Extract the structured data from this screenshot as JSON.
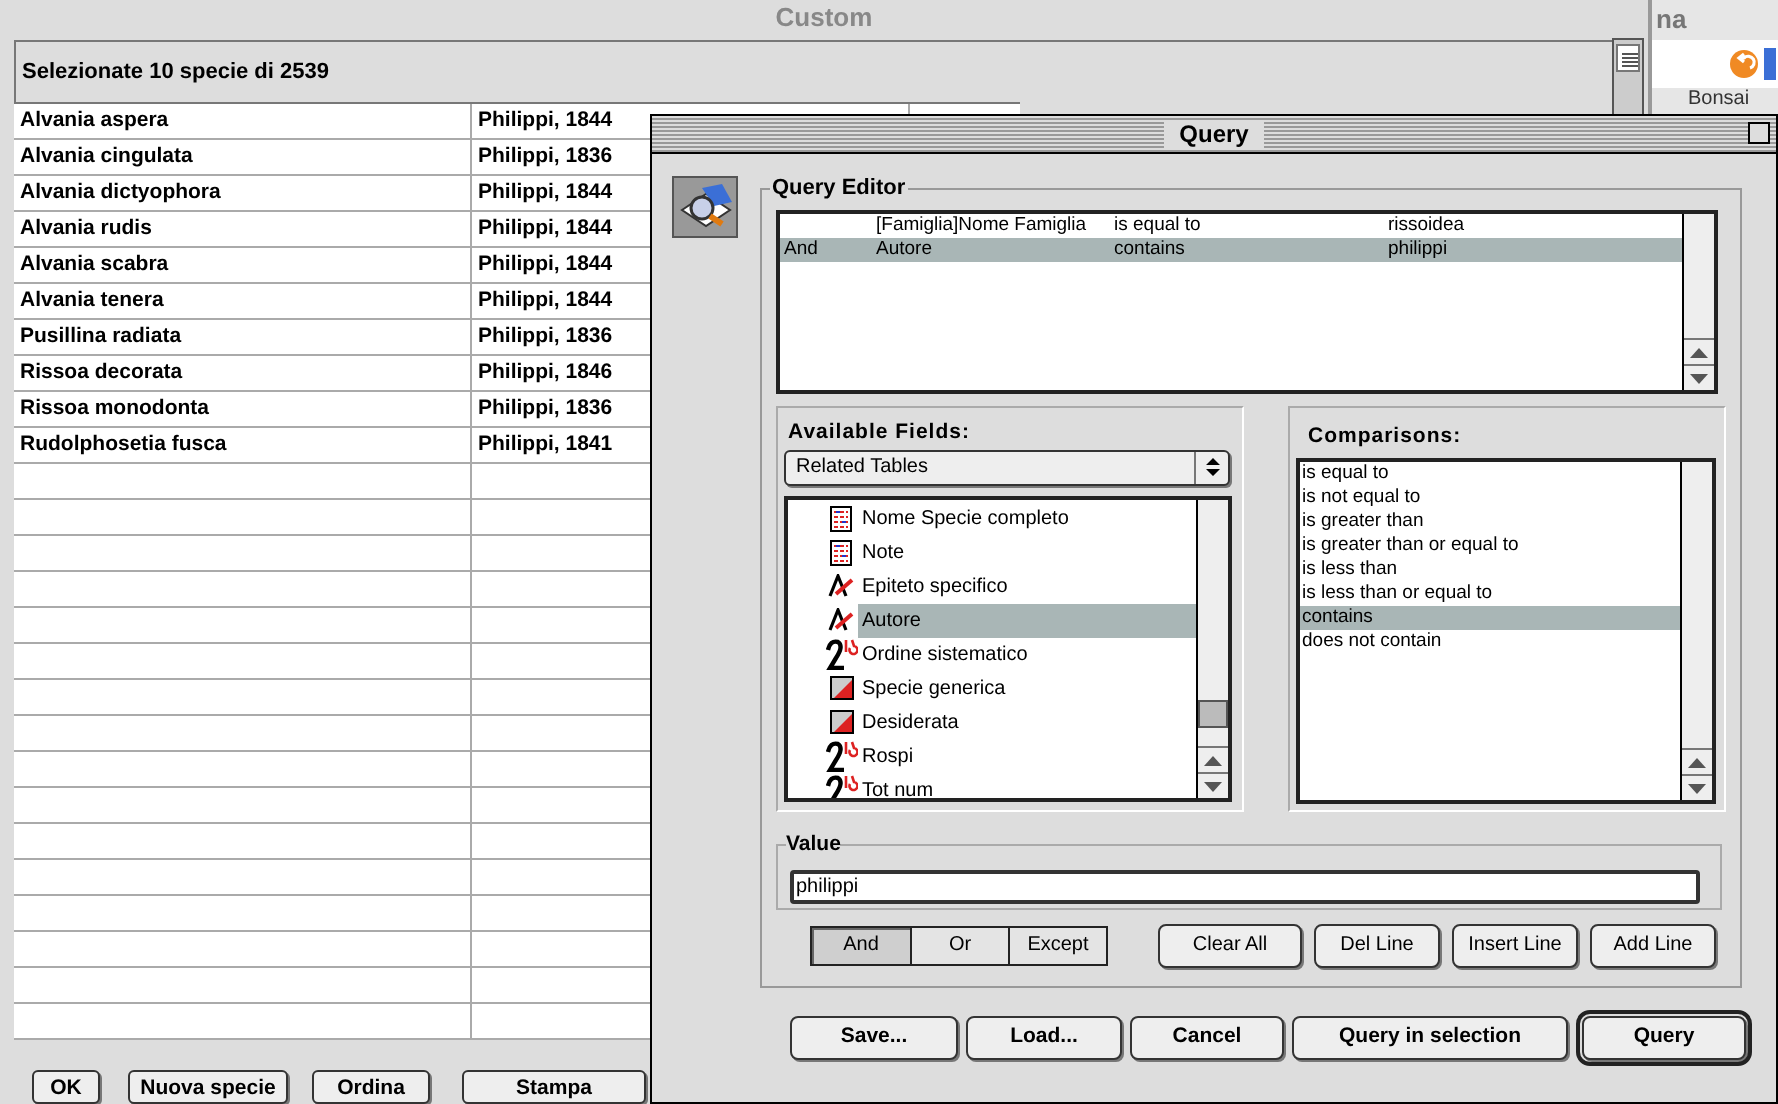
{
  "custom_window": {
    "title": "Custom",
    "header": "Selezionate 10 specie di 2539",
    "rows": [
      {
        "name": "Alvania aspera",
        "author": "Philippi, 1844"
      },
      {
        "name": "Alvania cingulata",
        "author": "Philippi, 1836"
      },
      {
        "name": "Alvania dictyophora",
        "author": "Philippi, 1844"
      },
      {
        "name": "Alvania rudis",
        "author": "Philippi, 1844"
      },
      {
        "name": "Alvania scabra",
        "author": "Philippi, 1844"
      },
      {
        "name": "Alvania tenera",
        "author": "Philippi, 1844"
      },
      {
        "name": "Pusillina radiata",
        "author": "Philippi, 1836"
      },
      {
        "name": "Rissoa decorata",
        "author": "Philippi, 1846"
      },
      {
        "name": "Rissoa monodonta",
        "author": "Philippi, 1836"
      },
      {
        "name": "Rudolphosetia fusca",
        "author": "Philippi, 1841"
      }
    ],
    "buttons": [
      "OK",
      "Nuova specie",
      "Ordina",
      "Stampa"
    ]
  },
  "background_window": {
    "title_fragment": "na",
    "tab_fragment": "Bonsai"
  },
  "query_window": {
    "title": "Query",
    "editor": {
      "label": "Query Editor",
      "rows": [
        {
          "field": "[Famiglia]Nome Famiglia",
          "comparison": "is equal to",
          "value": "rissoidea",
          "selected": false
        },
        {
          "conjunction": "And",
          "field": "Autore",
          "comparison": "contains",
          "value": "philippi",
          "selected": true
        }
      ]
    },
    "fields": {
      "label": "Available Fields:",
      "dropdown": "Related Tables",
      "items": [
        {
          "label": "Nome Specie completo",
          "kind": "text",
          "selected": false
        },
        {
          "label": "Note",
          "kind": "text",
          "selected": false
        },
        {
          "label": "Epiteto specifico",
          "kind": "alpha",
          "selected": false
        },
        {
          "label": "Autore",
          "kind": "alpha",
          "selected": true
        },
        {
          "label": "Ordine sistematico",
          "kind": "number",
          "selected": false
        },
        {
          "label": "Specie generica",
          "kind": "boolean",
          "selected": false
        },
        {
          "label": "Desiderata",
          "kind": "boolean",
          "selected": false
        },
        {
          "label": "Rospi",
          "kind": "number",
          "selected": false
        },
        {
          "label": "Tot num",
          "kind": "number",
          "selected": false
        }
      ]
    },
    "comparisons": {
      "label": "Comparisons:",
      "items": [
        {
          "label": "is equal to",
          "selected": false
        },
        {
          "label": "is not equal to",
          "selected": false
        },
        {
          "label": "is greater than",
          "selected": false
        },
        {
          "label": "is greater than or equal to",
          "selected": false
        },
        {
          "label": "is less than",
          "selected": false
        },
        {
          "label": "is less than or equal to",
          "selected": false
        },
        {
          "label": "contains",
          "selected": true
        },
        {
          "label": "does not contain",
          "selected": false
        }
      ]
    },
    "value": {
      "label": "Value",
      "value": "philippi"
    },
    "operators": [
      {
        "label": "And",
        "selected": true
      },
      {
        "label": "Or",
        "selected": false
      },
      {
        "label": "Except",
        "selected": false
      }
    ],
    "line_buttons": [
      "Clear All",
      "Del Line",
      "Insert Line",
      "Add Line"
    ],
    "buttons": [
      {
        "label": "Save...",
        "default": false
      },
      {
        "label": "Load...",
        "default": false
      },
      {
        "label": "Cancel",
        "default": false
      },
      {
        "label": "Query in selection",
        "default": false
      },
      {
        "label": "Query",
        "default": true
      }
    ]
  }
}
